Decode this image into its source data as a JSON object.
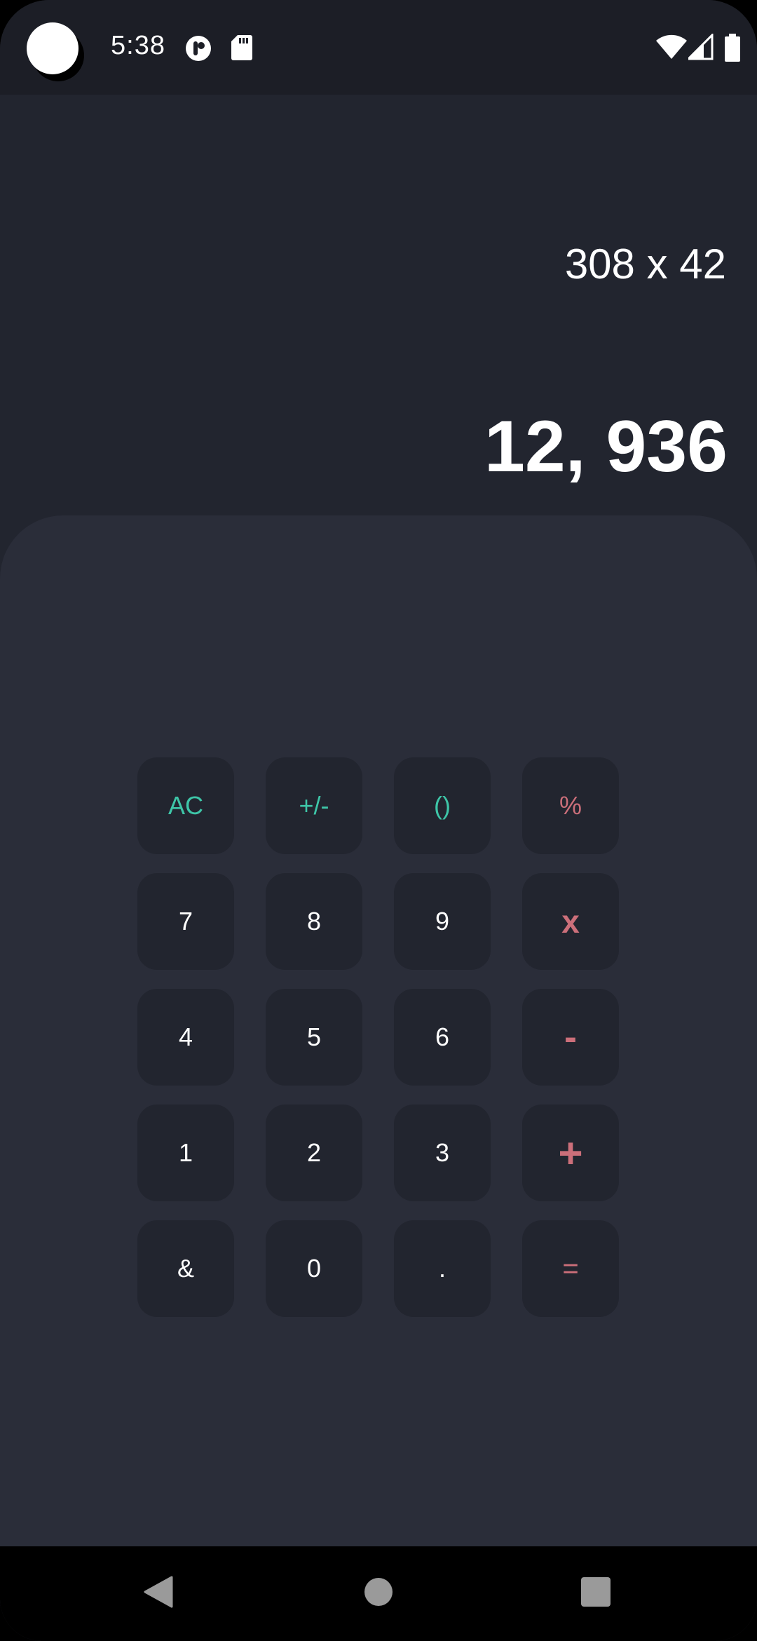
{
  "status_bar": {
    "time": "5:38",
    "icons_left": [
      "notification-app-icon",
      "sd-card-icon"
    ],
    "icons_right": [
      "wifi-icon",
      "signal-icon",
      "battery-icon"
    ]
  },
  "display": {
    "expression": "308 x 42",
    "result": "12, 936"
  },
  "keypad": {
    "rows": [
      [
        {
          "label": "AC",
          "name": "key-ac"
        },
        {
          "label": "+/-",
          "name": "key-plus-minus"
        },
        {
          "label": "()",
          "name": "key-parentheses"
        },
        {
          "label": "%",
          "name": "key-percent"
        }
      ],
      [
        {
          "label": "7",
          "name": "key-7"
        },
        {
          "label": "8",
          "name": "key-8"
        },
        {
          "label": "9",
          "name": "key-9"
        },
        {
          "label": "x",
          "name": "key-multiply"
        }
      ],
      [
        {
          "label": "4",
          "name": "key-4"
        },
        {
          "label": "5",
          "name": "key-5"
        },
        {
          "label": "6",
          "name": "key-6"
        },
        {
          "label": "-",
          "name": "key-subtract"
        }
      ],
      [
        {
          "label": "1",
          "name": "key-1"
        },
        {
          "label": "2",
          "name": "key-2"
        },
        {
          "label": "3",
          "name": "key-3"
        },
        {
          "label": "+",
          "name": "key-add"
        }
      ],
      [
        {
          "label": "&",
          "name": "key-ampersand"
        },
        {
          "label": "0",
          "name": "key-0"
        },
        {
          "label": ".",
          "name": "key-decimal"
        },
        {
          "label": "=",
          "name": "key-equals"
        }
      ]
    ]
  },
  "nav_bar": {
    "buttons": [
      "back-icon",
      "home-icon",
      "recents-icon"
    ]
  },
  "colors": {
    "background": "#22252f",
    "panel": "#2a2d39",
    "key": "#22252f",
    "function_accent": "#3ec6a8",
    "operator_accent": "#cc6f7a",
    "text": "#ffffff"
  }
}
